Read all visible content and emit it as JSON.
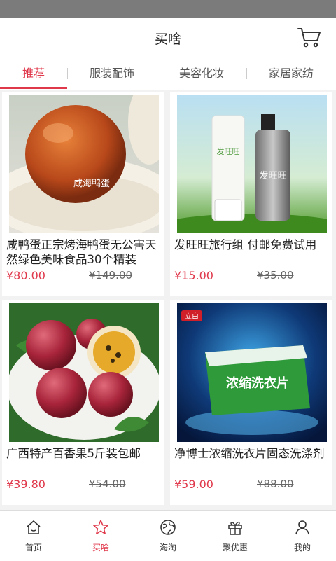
{
  "header": {
    "title": "买啥",
    "cart_icon": "cart-icon"
  },
  "tabs": [
    {
      "label": "推荐",
      "active": true
    },
    {
      "label": "服装配饰",
      "active": false
    },
    {
      "label": "美容化妆",
      "active": false
    },
    {
      "label": "家居家纺",
      "active": false
    }
  ],
  "products": [
    {
      "name": "咸鸭蛋正宗烤海鸭蛋无公害天然绿色美味食品30个精装",
      "price": "¥80.00",
      "original_price": "¥149.00",
      "image_caption": "咸海鸭蛋"
    },
    {
      "name": "发旺旺旅行组 付邮免费试用",
      "price": "¥15.00",
      "original_price": "¥35.00",
      "image_text": {
        "brand": "发旺旺",
        "tube_label": "发旺旺",
        "bottle_label": "发旺旺"
      }
    },
    {
      "name": "广西特产百香果5斤装包邮",
      "price": "¥39.80",
      "original_price": "¥54.00"
    },
    {
      "name": "净博士浓缩洗衣片固态洗涤剂",
      "price": "¥59.00",
      "original_price": "¥88.00",
      "image_text": {
        "brand": "立白",
        "product": "浓缩洗衣片"
      }
    }
  ],
  "bottom_nav": [
    {
      "label": "首页",
      "icon": "home-icon",
      "active": false
    },
    {
      "label": "买啥",
      "icon": "star-icon",
      "active": true
    },
    {
      "label": "海淘",
      "icon": "globe-icon",
      "active": false
    },
    {
      "label": "聚优惠",
      "icon": "gift-icon",
      "active": false
    },
    {
      "label": "我的",
      "icon": "user-icon",
      "active": false
    }
  ],
  "colors": {
    "accent": "#e0384b",
    "status_bar": "#7b7b7b",
    "background": "#f2f2f2"
  }
}
